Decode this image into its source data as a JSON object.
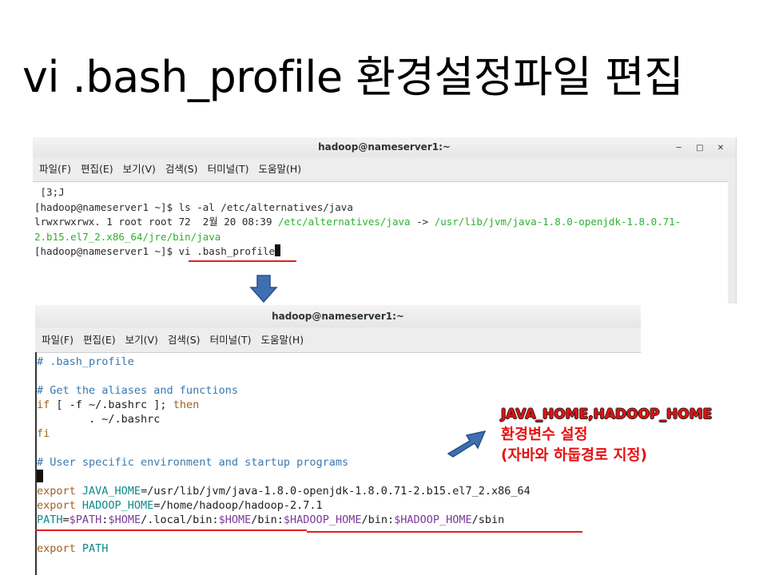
{
  "slide": {
    "title": "vi .bash_profile 환경설정파일 편집"
  },
  "window1": {
    "title": "hadoop@nameserver1:~",
    "controls": {
      "minimize": "─",
      "maximize": "□",
      "close": "✕"
    },
    "menu": [
      "파일(F)",
      "편집(E)",
      "보기(V)",
      "검색(S)",
      "터미널(T)",
      "도움말(H)"
    ],
    "lines": {
      "l1": " [3;J",
      "l2": "[hadoop@nameserver1 ~]$ ls -al /etc/alternatives/java",
      "l3a": "lrwxrwxrwx. 1 root root 72  2월 20 08:39 ",
      "l3b": "/etc/alternatives/java",
      "l3c": " -> ",
      "l3d": "/usr/lib/jvm/java-1.8.0-openjdk-1.8.0.71-",
      "l4": "2.b15.el7_2.x86_64/jre/bin/java",
      "l5": "[hadoop@nameserver1 ~]$ vi .bash_profile"
    }
  },
  "window2": {
    "title": "hadoop@nameserver1:~",
    "menu": [
      "파일(F)",
      "편집(E)",
      "보기(V)",
      "검색(S)",
      "터미널(T)",
      "도움말(H)"
    ],
    "lines": {
      "c1": "# .bash_profile",
      "c2": "# Get the aliases and functions",
      "if_kw": "if",
      "if_mid": " [ -f ~/.bashrc ]; ",
      "then_kw": "then",
      "dot_line": "        . ~/.bashrc",
      "fi_kw": "fi",
      "c3": "# User specific environment and startup programs",
      "export1_kw": "export",
      "java_var": " JAVA_HOME",
      "java_val": "=/usr/lib/jvm/java-1.8.0-openjdk-1.8.0.71-2.b15.el7_2.x86_64",
      "export2_kw": "export",
      "hadoop_var": " HADOOP_HOME",
      "hadoop_val": "=/home/hadoop/hadoop-2.7.1",
      "path_var": "PATH",
      "path_eq": "=",
      "path_ref": "$PATH",
      "sep1": ":",
      "home_ref1": "$HOME",
      "local_bin": "/.local/bin",
      "sep2": ":",
      "home_ref2": "$HOME",
      "bin": "/bin",
      "sep3": ":",
      "hadoop_ref1": "$HADOOP_HOME",
      "bin2": "/bin",
      "sep4": ":",
      "hadoop_ref2": "$HADOOP_HOME",
      "sbin": "/sbin",
      "export3_kw": "export",
      "path_var2": " PATH"
    }
  },
  "annotation": {
    "line1": "JAVA_HOME,HADOOP_HOME",
    "line2": "환경변수 설정",
    "line3": "(자바와 하둡경로 지정)"
  },
  "colors": {
    "accent_red": "#e02020",
    "arrow_blue": "#3f6fb0",
    "path_green": "#2fb02f"
  }
}
